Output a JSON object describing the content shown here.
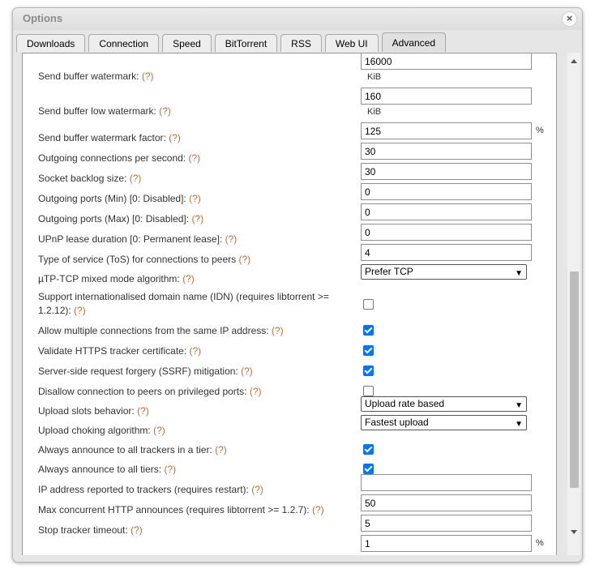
{
  "window": {
    "title": "Options",
    "close_label": "×"
  },
  "tabs": [
    {
      "label": "Downloads"
    },
    {
      "label": "Connection"
    },
    {
      "label": "Speed"
    },
    {
      "label": "BitTorrent"
    },
    {
      "label": "RSS"
    },
    {
      "label": "Web UI"
    },
    {
      "label": "Advanced",
      "active": true
    }
  ],
  "help_marker": "(?)",
  "settings": {
    "send_buffer_watermark": {
      "label": "Send buffer watermark:",
      "value": "16000",
      "unit": "KiB"
    },
    "send_buffer_low_watermark": {
      "label": "Send buffer low watermark:",
      "value": "160",
      "unit": "KiB"
    },
    "send_buffer_watermark_factor": {
      "label": "Send buffer watermark factor:",
      "value": "125",
      "unit": "%"
    },
    "outgoing_connections_per_second": {
      "label": "Outgoing connections per second:",
      "value": "30"
    },
    "socket_backlog_size": {
      "label": "Socket backlog size:",
      "value": "30"
    },
    "outgoing_ports_min": {
      "label": "Outgoing ports (Min) [0: Disabled]:",
      "value": "0"
    },
    "outgoing_ports_max": {
      "label": "Outgoing ports (Max) [0: Disabled]:",
      "value": "0"
    },
    "upnp_lease_duration": {
      "label": "UPnP lease duration [0: Permanent lease]:",
      "value": "0"
    },
    "type_of_service": {
      "label": "Type of service (ToS) for connections to peers",
      "value": "4"
    },
    "utp_tcp_mixed_mode": {
      "label": "µTP-TCP mixed mode algorithm:",
      "selected": "Prefer TCP"
    },
    "idn_support": {
      "label": "Support internationalised domain name (IDN) (requires libtorrent >= 1.2.12):",
      "checked": false
    },
    "multiple_connections_same_ip": {
      "label": "Allow multiple connections from the same IP address:",
      "checked": true
    },
    "validate_https_tracker_cert": {
      "label": "Validate HTTPS tracker certificate:",
      "checked": true
    },
    "ssrf_mitigation": {
      "label": "Server-side request forgery (SSRF) mitigation:",
      "checked": true
    },
    "disallow_privileged_ports": {
      "label": "Disallow connection to peers on privileged ports:",
      "checked": false
    },
    "upload_slots_behavior": {
      "label": "Upload slots behavior:",
      "selected": "Upload rate based"
    },
    "upload_choking_algorithm": {
      "label": "Upload choking algorithm:",
      "selected": "Fastest upload"
    },
    "announce_all_trackers_in_tier": {
      "label": "Always announce to all trackers in a tier:",
      "checked": true
    },
    "announce_all_tiers": {
      "label": "Always announce to all tiers:",
      "checked": true
    },
    "ip_reported_to_trackers": {
      "label": "IP address reported to trackers (requires restart):",
      "value": ""
    },
    "max_concurrent_http_announces": {
      "label": "Max concurrent HTTP announces (requires libtorrent >= 1.2.7):",
      "value": "50"
    },
    "stop_tracker_timeout": {
      "label": "Stop tracker timeout:",
      "value": "5"
    },
    "partial_row": {
      "value": "1",
      "unit": "%"
    }
  },
  "colors": {
    "help": "#c86b2c",
    "checkbox": "#0075ff"
  }
}
